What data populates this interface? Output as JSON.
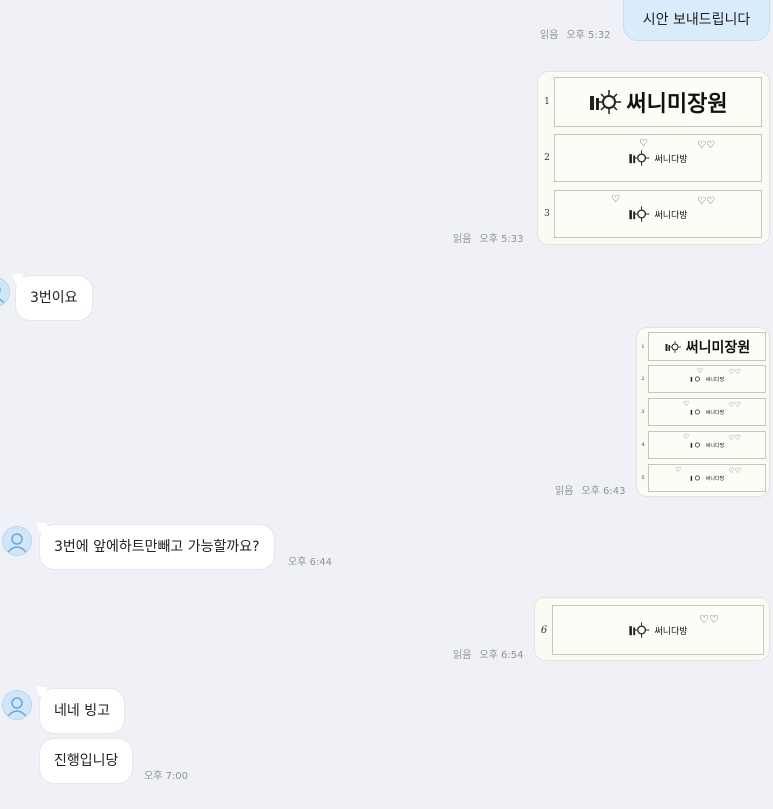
{
  "messages": {
    "m1": {
      "text": "시안 보내드립니다",
      "read": "읽음",
      "time": "오후 5:32"
    },
    "m2": {
      "read": "읽음",
      "time": "오후 5:33",
      "signs": [
        {
          "num": "1",
          "text": "써니미장원"
        },
        {
          "num": "2",
          "text": "써니다방"
        },
        {
          "num": "3",
          "text": "써니다방"
        }
      ]
    },
    "m3": {
      "text": "3번이요"
    },
    "m4": {
      "read": "읽음",
      "time": "오후 6:43",
      "signs": [
        {
          "num": "1",
          "text": "써니미장원"
        },
        {
          "num": "2",
          "text": "써니다방"
        },
        {
          "num": "3",
          "text": "써니다방"
        },
        {
          "num": "4",
          "text": "써니다방"
        },
        {
          "num": "5",
          "text": "써니다방"
        }
      ]
    },
    "m5": {
      "text": "3번에 앞에하트만빼고 가능할까요?",
      "time": "오후 6:44"
    },
    "m6": {
      "read": "읽음",
      "time": "오후 6:54",
      "signs": [
        {
          "num": "6",
          "text": "써니다방"
        }
      ]
    },
    "m7": {
      "text": "네네 빙고"
    },
    "m8": {
      "text": "진행입니당",
      "time": "오후 7:00"
    }
  },
  "icons": {
    "avatar": "user-avatar-icon",
    "logo": "sun-scissors-logo-icon"
  },
  "colors": {
    "background": "#eff1f6",
    "my_bubble": "#d8ecfb",
    "their_bubble": "#ffffff",
    "meta_text": "#8e9298"
  }
}
